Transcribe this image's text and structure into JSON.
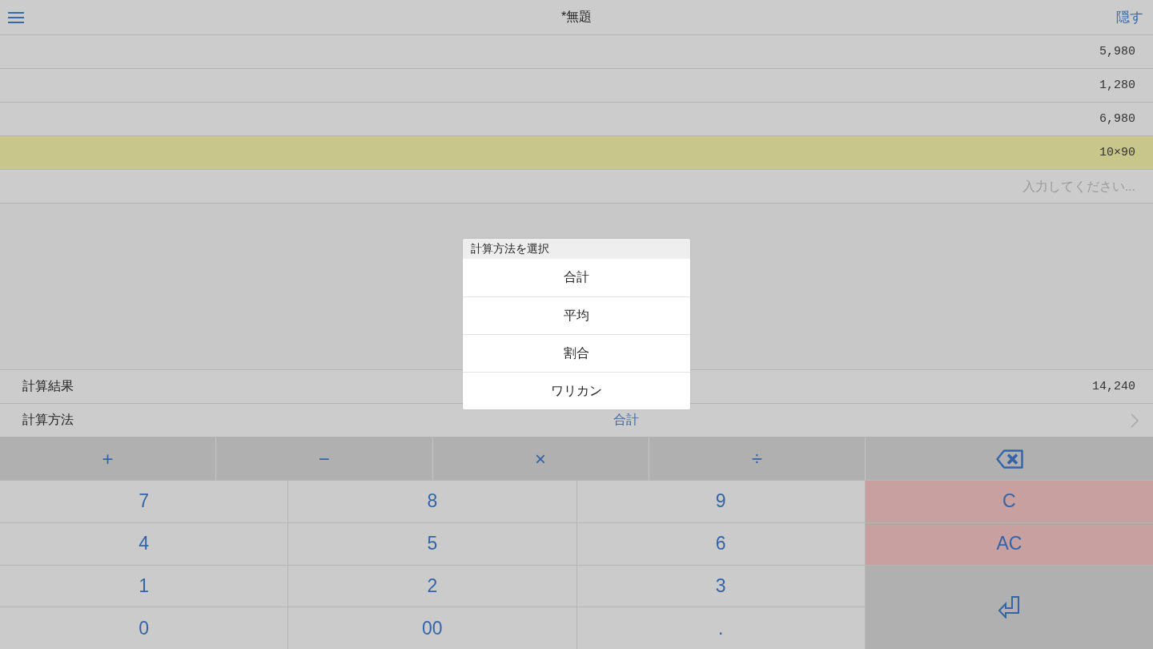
{
  "header": {
    "title": "*無題",
    "hide_button": "隠す"
  },
  "entries": [
    {
      "value": "5,980",
      "selected": false
    },
    {
      "value": "1,280",
      "selected": false
    },
    {
      "value": "6,980",
      "selected": false
    },
    {
      "value": "10×90",
      "selected": true
    }
  ],
  "input": {
    "placeholder": "入力してください..."
  },
  "result": {
    "label": "計算結果",
    "value": "14,240"
  },
  "method": {
    "label": "計算方法",
    "value": "合計"
  },
  "operator_keys": [
    {
      "kind": "symbol",
      "label": "+"
    },
    {
      "kind": "symbol",
      "label": "−"
    },
    {
      "kind": "symbol",
      "label": "×"
    },
    {
      "kind": "symbol",
      "label": "÷"
    },
    {
      "kind": "backspace"
    }
  ],
  "keypad": [
    {
      "kind": "digit",
      "label": "7"
    },
    {
      "kind": "digit",
      "label": "8"
    },
    {
      "kind": "digit",
      "label": "9"
    },
    {
      "kind": "clear",
      "label": "C"
    },
    {
      "kind": "digit",
      "label": "4"
    },
    {
      "kind": "digit",
      "label": "5"
    },
    {
      "kind": "digit",
      "label": "6"
    },
    {
      "kind": "clear",
      "label": "AC"
    },
    {
      "kind": "digit",
      "label": "1"
    },
    {
      "kind": "digit",
      "label": "2"
    },
    {
      "kind": "digit",
      "label": "3"
    },
    {
      "kind": "enter"
    },
    {
      "kind": "digit",
      "label": "0"
    },
    {
      "kind": "digit",
      "label": "00"
    },
    {
      "kind": "digit",
      "label": "."
    }
  ],
  "dialog": {
    "title": "計算方法を選択",
    "options": [
      "合計",
      "平均",
      "割合",
      "ワリカン"
    ]
  }
}
